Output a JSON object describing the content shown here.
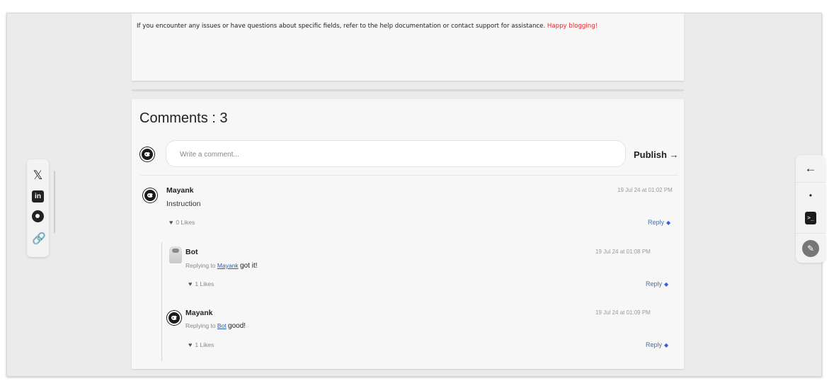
{
  "article": {
    "closing_text": "If you encounter any issues or have questions about specific fields, refer to the help documentation or contact support for assistance.",
    "closing_highlight": "Happy blogging!"
  },
  "comments": {
    "title": "Comments : 3",
    "input_placeholder": "Write a comment...",
    "publish_label": "Publish →",
    "items": [
      {
        "author": "Mayank",
        "text": "Instruction",
        "date": "19 Jul 24 at 01:02 PM",
        "likes": "0 Likes",
        "reply_label": "Reply"
      },
      {
        "author": "Bot",
        "replying_prefix": "Replying to",
        "replying_to": "Mayank",
        "text": "got it!",
        "date": "19 Jul 24 at 01:08 PM",
        "likes": "1 Likes",
        "reply_label": "Reply"
      },
      {
        "author": "Mayank",
        "replying_prefix": "Replying to",
        "replying_to": "Bot",
        "text": "good!",
        "date": "19 Jul 24 at 01:09 PM",
        "likes": "1 Likes",
        "reply_label": "Reply"
      }
    ]
  },
  "share_bar": {
    "x_glyph": "𝕏",
    "linkedin_glyph": "in",
    "link_glyph": "🔗"
  },
  "tool_bar": {
    "back_glyph": "←",
    "dot_glyph": "•",
    "terminal_glyph": ">_",
    "edit_glyph": "✎"
  },
  "colors": {
    "highlight": "#e3262a",
    "mention": "#2a5db0",
    "reply": "#4a6fa5"
  }
}
